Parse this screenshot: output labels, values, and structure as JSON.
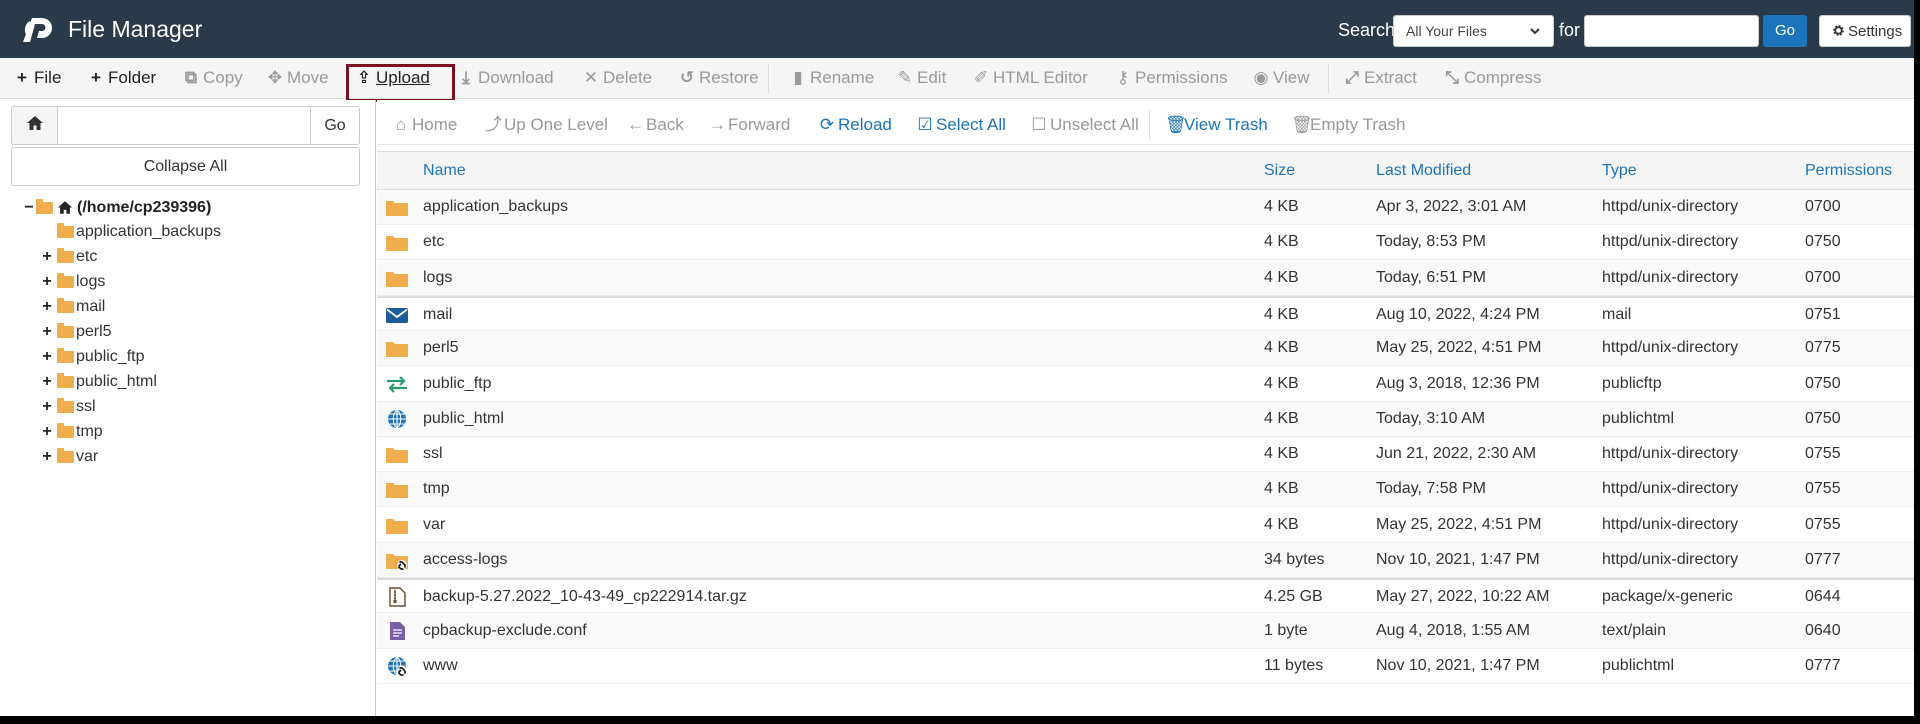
{
  "header": {
    "app_title": "File Manager",
    "search_label": "Search",
    "search_scope": "All Your Files",
    "for_label": "for",
    "search_value": "",
    "go_label": "Go",
    "settings_label": "Settings",
    "bg_color": "#293a4a",
    "accent_color": "#1c75bc"
  },
  "toolbar": {
    "file": "File",
    "folder": "Folder",
    "copy": "Copy",
    "move": "Move",
    "upload": "Upload",
    "download": "Download",
    "delete": "Delete",
    "restore": "Restore",
    "rename": "Rename",
    "edit": "Edit",
    "html_editor": "HTML Editor",
    "permissions": "Permissions",
    "view": "View",
    "extract": "Extract",
    "compress": "Compress"
  },
  "left_pane": {
    "path_value": "",
    "go_label": "Go",
    "collapse_all": "Collapse All",
    "root_label": "(/home/cp239396)",
    "tree": [
      {
        "label": "application_backups",
        "expandable": false
      },
      {
        "label": "etc",
        "expandable": true
      },
      {
        "label": "logs",
        "expandable": true
      },
      {
        "label": "mail",
        "expandable": true
      },
      {
        "label": "perl5",
        "expandable": true
      },
      {
        "label": "public_ftp",
        "expandable": true
      },
      {
        "label": "public_html",
        "expandable": true
      },
      {
        "label": "ssl",
        "expandable": true
      },
      {
        "label": "tmp",
        "expandable": true
      },
      {
        "label": "var",
        "expandable": true
      }
    ]
  },
  "nav": {
    "home": "Home",
    "up": "Up One Level",
    "back": "Back",
    "forward": "Forward",
    "reload": "Reload",
    "select_all": "Select All",
    "unselect_all": "Unselect All",
    "view_trash": "View Trash",
    "empty_trash": "Empty Trash"
  },
  "table": {
    "columns": [
      "Name",
      "Size",
      "Last Modified",
      "Type",
      "Permissions"
    ],
    "rows": [
      {
        "icon": "folder-icon",
        "name": "application_backups",
        "size": "4 KB",
        "modified": "Apr 3, 2022, 3:01 AM",
        "type": "httpd/unix-directory",
        "perms": "0700"
      },
      {
        "icon": "folder-icon",
        "name": "etc",
        "size": "4 KB",
        "modified": "Today, 8:53 PM",
        "type": "httpd/unix-directory",
        "perms": "0750"
      },
      {
        "icon": "folder-icon",
        "name": "logs",
        "size": "4 KB",
        "modified": "Today, 6:51 PM",
        "type": "httpd/unix-directory",
        "perms": "0700"
      },
      {
        "icon": "mail-icon",
        "name": "mail",
        "size": "4 KB",
        "modified": "Aug 10, 2022, 4:24 PM",
        "type": "mail",
        "perms": "0751"
      },
      {
        "icon": "folder-icon",
        "name": "perl5",
        "size": "4 KB",
        "modified": "May 25, 2022, 4:51 PM",
        "type": "httpd/unix-directory",
        "perms": "0775"
      },
      {
        "icon": "transfer-icon",
        "name": "public_ftp",
        "size": "4 KB",
        "modified": "Aug 3, 2018, 12:36 PM",
        "type": "publicftp",
        "perms": "0750"
      },
      {
        "icon": "globe-icon",
        "name": "public_html",
        "size": "4 KB",
        "modified": "Today, 3:10 AM",
        "type": "publichtml",
        "perms": "0750"
      },
      {
        "icon": "folder-icon",
        "name": "ssl",
        "size": "4 KB",
        "modified": "Jun 21, 2022, 2:30 AM",
        "type": "httpd/unix-directory",
        "perms": "0755"
      },
      {
        "icon": "folder-icon",
        "name": "tmp",
        "size": "4 KB",
        "modified": "Today, 7:58 PM",
        "type": "httpd/unix-directory",
        "perms": "0755"
      },
      {
        "icon": "folder-icon",
        "name": "var",
        "size": "4 KB",
        "modified": "May 25, 2022, 4:51 PM",
        "type": "httpd/unix-directory",
        "perms": "0755"
      },
      {
        "icon": "folder-link-icon",
        "name": "access-logs",
        "size": "34 bytes",
        "modified": "Nov 10, 2021, 1:47 PM",
        "type": "httpd/unix-directory",
        "perms": "0777"
      },
      {
        "icon": "archive-icon",
        "name": "backup-5.27.2022_10-43-49_cp222914.tar.gz",
        "size": "4.25 GB",
        "modified": "May 27, 2022, 10:22 AM",
        "type": "package/x-generic",
        "perms": "0644"
      },
      {
        "icon": "text-file-icon",
        "name": "cpbackup-exclude.conf",
        "size": "1 byte",
        "modified": "Aug 4, 2018, 1:55 AM",
        "type": "text/plain",
        "perms": "0640"
      },
      {
        "icon": "globe-link-icon",
        "name": "www",
        "size": "11 bytes",
        "modified": "Nov 10, 2021, 1:47 PM",
        "type": "publichtml",
        "perms": "0777"
      }
    ]
  }
}
